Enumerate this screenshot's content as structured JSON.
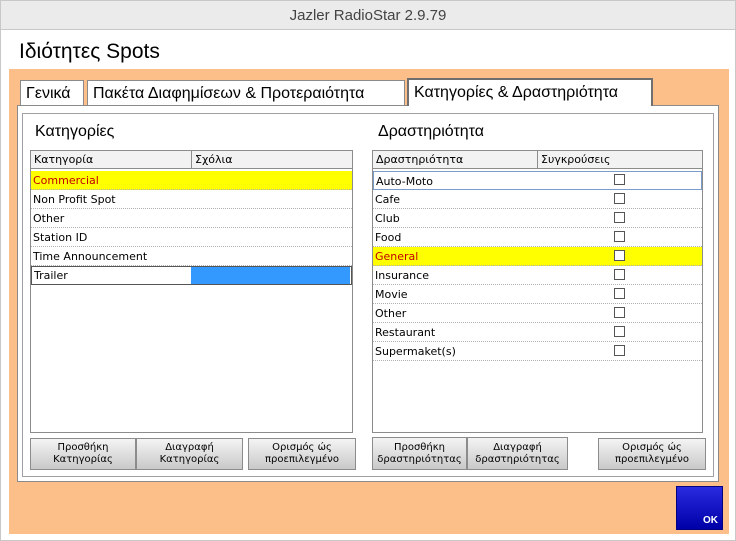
{
  "window": {
    "title": "Jazler RadioStar 2.9.79"
  },
  "dialog": {
    "title": "Ιδιότητες Spots"
  },
  "tabs": [
    {
      "label": "Γενικά"
    },
    {
      "label": "Πακέτα Διαφημίσεων & Προτεραιότητα"
    },
    {
      "label": "Κατηγορίες & Δραστηριότητα"
    }
  ],
  "categories": {
    "title": "Κατηγορίες",
    "columns": [
      "Κατηγορία",
      "Σχόλια"
    ],
    "rows": [
      "Commercial",
      "Non Profit Spot",
      "Other",
      "Station ID",
      "Time Announcement",
      "Trailer"
    ],
    "buttons": {
      "add": "Προσθήκη Κατηγορίας",
      "delete": "Διαγραφή Κατηγορίας",
      "default": "Ορισμός ώς προεπιλεγμένο"
    }
  },
  "activity": {
    "title": "Δραστηριότητα",
    "columns": [
      "Δραστηριότητα",
      "Συγκρούσεις"
    ],
    "rows": [
      "Auto-Moto",
      "Cafe",
      "Club",
      "Food",
      "General",
      "Insurance",
      "Movie",
      "Other",
      "Restaurant",
      "Supermaket(s)"
    ],
    "buttons": {
      "add": "Προσθήκη δραστηριότητας",
      "delete": "Διαγραφή δραστηριότητας",
      "default": "Ορισμός ώς προεπιλεγμένο"
    }
  },
  "ok": {
    "label": "OK"
  },
  "colors": {
    "accent": "#fcbf8a",
    "selected_row": "#ffff00",
    "selected_text": "#c00000",
    "ok_button": "#1a1ad0"
  }
}
